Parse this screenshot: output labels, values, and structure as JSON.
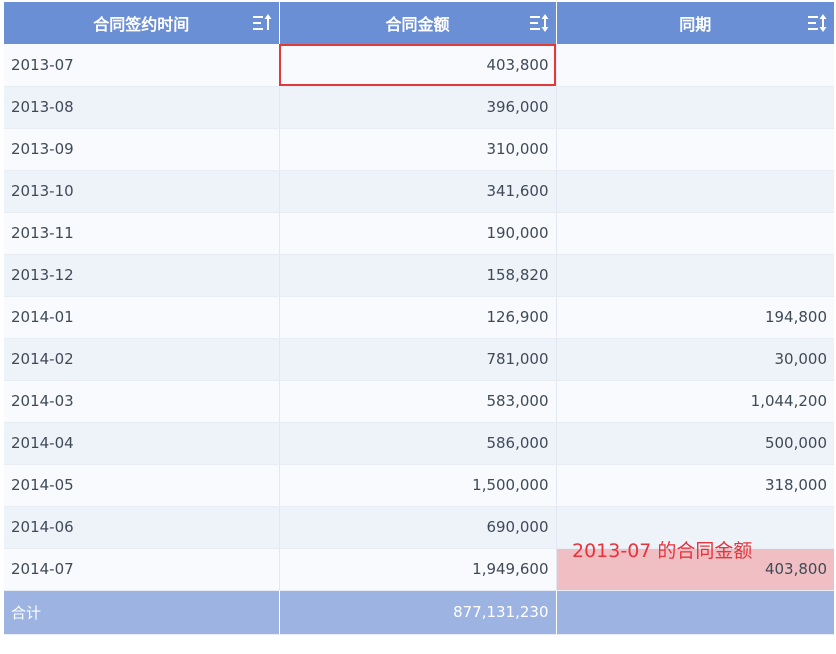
{
  "columns": [
    {
      "label": "合同签约时间",
      "sort_icon": "sort-asc-icon"
    },
    {
      "label": "合同金额",
      "sort_icon": "sort-both-icon"
    },
    {
      "label": "同期",
      "sort_icon": "sort-both-icon"
    }
  ],
  "rows": [
    {
      "date": "2013-07",
      "amount": "403,800",
      "prior": ""
    },
    {
      "date": "2013-08",
      "amount": "396,000",
      "prior": ""
    },
    {
      "date": "2013-09",
      "amount": "310,000",
      "prior": ""
    },
    {
      "date": "2013-10",
      "amount": "341,600",
      "prior": ""
    },
    {
      "date": "2013-11",
      "amount": "190,000",
      "prior": ""
    },
    {
      "date": "2013-12",
      "amount": "158,820",
      "prior": ""
    },
    {
      "date": "2014-01",
      "amount": "126,900",
      "prior": "194,800"
    },
    {
      "date": "2014-02",
      "amount": "781,000",
      "prior": "30,000"
    },
    {
      "date": "2014-03",
      "amount": "583,000",
      "prior": "1,044,200"
    },
    {
      "date": "2014-04",
      "amount": "586,000",
      "prior": "500,000"
    },
    {
      "date": "2014-05",
      "amount": "1,500,000",
      "prior": "318,000"
    },
    {
      "date": "2014-06",
      "amount": "690,000",
      "prior": ""
    },
    {
      "date": "2014-07",
      "amount": "1,949,600",
      "prior": "403,800"
    }
  ],
  "total": {
    "label": "合计",
    "amount": "877,131,230",
    "prior": ""
  },
  "annotation": "2013-07 的合同金额",
  "colors": {
    "header": "#6b8fd4",
    "total_row": "#9db4e2",
    "selection_border": "#e03a3a",
    "highlight_cell": "#f0bfc3",
    "annotation_text": "#e8333a"
  }
}
